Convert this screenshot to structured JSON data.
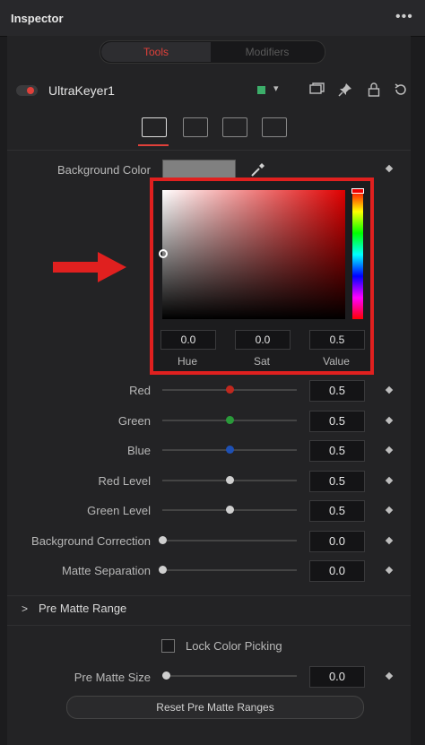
{
  "header": {
    "title": "Inspector",
    "menu_glyph": "•••"
  },
  "tabs": [
    {
      "label": "Tools",
      "active": true
    },
    {
      "label": "Modifiers",
      "active": false
    }
  ],
  "node": {
    "name": "UltraKeyer1",
    "color_chip": "#3cae6a"
  },
  "header_icons": [
    "window-icon",
    "pin-icon",
    "lock-icon",
    "reset-icon"
  ],
  "subtabs": [
    "controls-icon",
    "tuning-icon",
    "image-icon",
    "settings-icon"
  ],
  "background_color": {
    "label": "Background Color",
    "swatch": "#808080"
  },
  "color_picker": {
    "fields": [
      {
        "label": "Hue",
        "value": "0.0"
      },
      {
        "label": "Sat",
        "value": "0.0"
      },
      {
        "label": "Value",
        "value": "0.5"
      }
    ]
  },
  "sliders": [
    {
      "label": "Red",
      "value": "0.5",
      "knob_color": "#c0281e",
      "level": 0.5
    },
    {
      "label": "Green",
      "value": "0.5",
      "knob_color": "#2a9a3a",
      "level": 0.5
    },
    {
      "label": "Blue",
      "value": "0.5",
      "knob_color": "#1e50b4",
      "level": 0.5
    },
    {
      "label": "Red Level",
      "value": "0.5",
      "knob_color": "#cfcfcf",
      "level": 0.5
    },
    {
      "label": "Green Level",
      "value": "0.5",
      "knob_color": "#cfcfcf",
      "level": 0.5
    },
    {
      "label": "Background Correction",
      "value": "0.0",
      "knob_color": "#cfcfcf",
      "level": 0.0
    },
    {
      "label": "Matte Separation",
      "value": "0.0",
      "knob_color": "#cfcfcf",
      "level": 0.0
    }
  ],
  "pre_matte": {
    "section_label": "Pre Matte Range",
    "lock_label": "Lock Color Picking",
    "size_label": "Pre Matte Size",
    "size_value": "0.0",
    "size_level": 0.0,
    "reset_label": "Reset Pre Matte Ranges"
  },
  "accent_color": "#e0403a",
  "annotation_color": "#e0201f"
}
